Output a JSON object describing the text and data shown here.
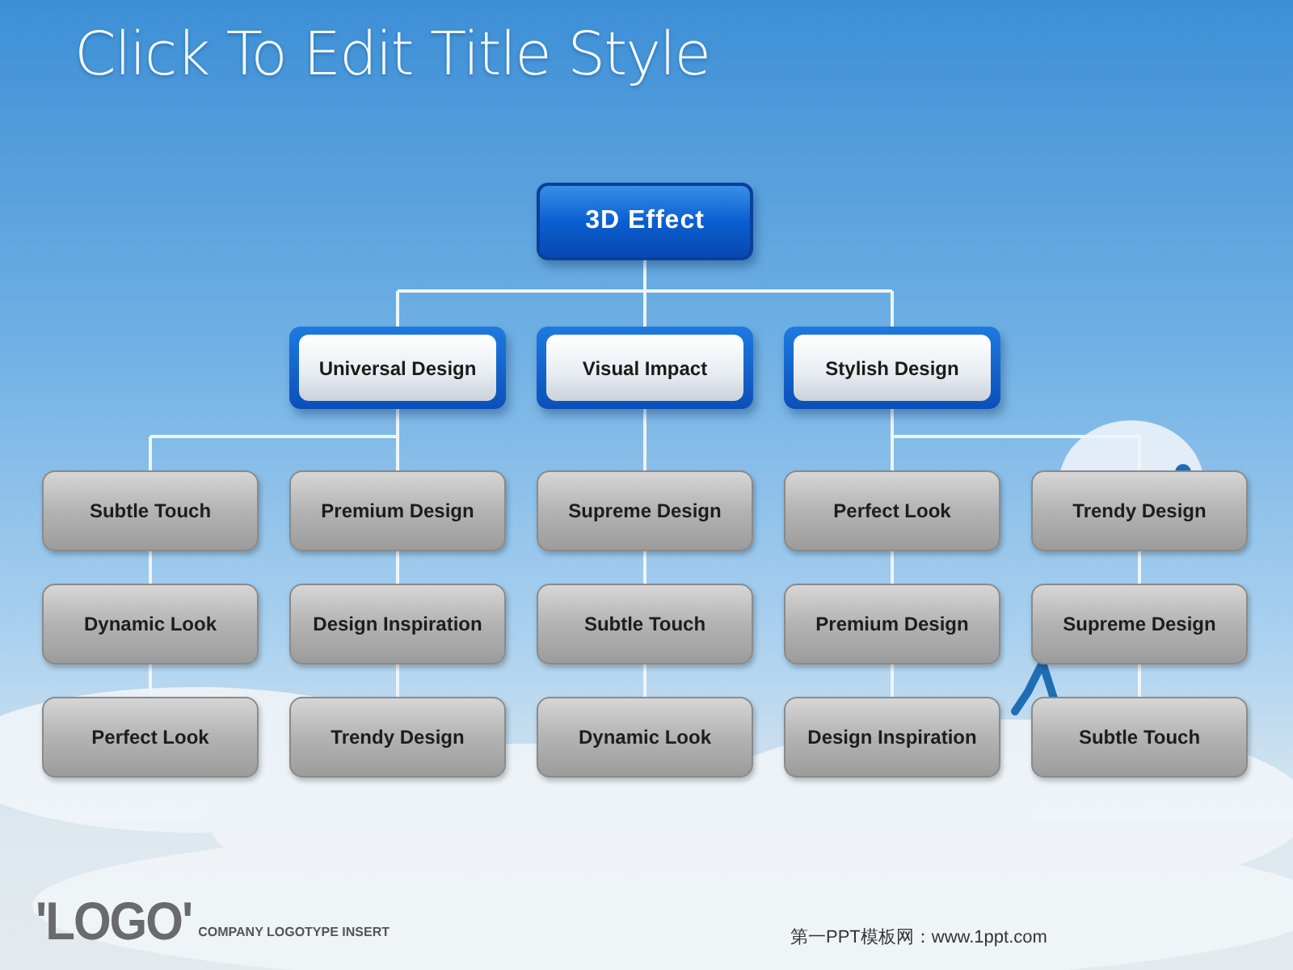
{
  "title": "Click To Edit Title Style",
  "chart": {
    "root": "3D Effect",
    "branches": [
      {
        "label": "Universal Design",
        "columns": [
          [
            "Subtle Touch",
            "Dynamic Look",
            "Perfect Look"
          ],
          [
            "Premium Design",
            "Design Inspiration",
            "Trendy Design"
          ]
        ]
      },
      {
        "label": "Visual Impact",
        "columns": [
          [
            "Supreme Design",
            "Subtle Touch",
            "Dynamic Look"
          ]
        ]
      },
      {
        "label": "Stylish Design",
        "columns": [
          [
            "Perfect Look",
            "Premium Design",
            "Design Inspiration"
          ],
          [
            "Trendy Design",
            "Supreme Design",
            "Subtle Touch"
          ]
        ]
      }
    ]
  },
  "footer": {
    "logo": "'LOGO'",
    "tagline": "COMPANY LOGOTYPE INSERT",
    "site": "第一PPT模板网：www.1ppt.com"
  }
}
